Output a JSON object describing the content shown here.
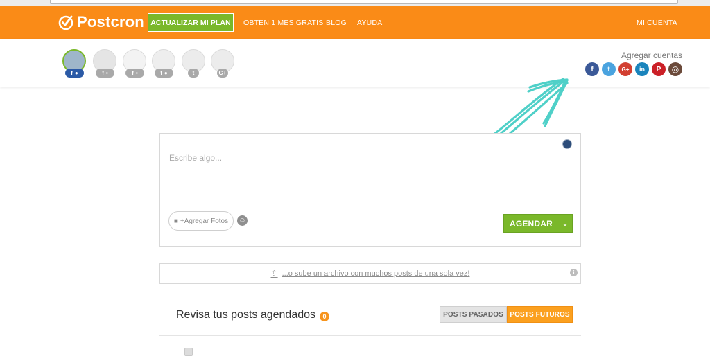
{
  "brand": {
    "name": "Postcron",
    "nav_color": "#fa8b17",
    "green": "#7ab82a"
  },
  "nav": {
    "upgrade_label": "ACTUALIZAR MI PLAN",
    "free_month_label": "OBTÉN 1 MES GRATIS",
    "blog_label": "BLOG",
    "help_label": "AYUDA",
    "account_label": "MI CUENTA"
  },
  "accounts": {
    "add_label": "Agregar cuentas",
    "connected": [
      {
        "network": "facebook",
        "badge": "f",
        "active": true
      },
      {
        "network": "facebook-page",
        "badge": "f",
        "active": false
      },
      {
        "network": "facebook-page",
        "badge": "f",
        "active": false
      },
      {
        "network": "facebook-group",
        "badge": "f",
        "active": false
      },
      {
        "network": "twitter",
        "badge": "t",
        "active": false
      },
      {
        "network": "google-plus",
        "badge": "G+",
        "active": false
      }
    ],
    "add_networks": [
      {
        "name": "facebook",
        "glyph": "f",
        "color": "#3b5998"
      },
      {
        "name": "twitter",
        "glyph": "t",
        "color": "#4aa3df"
      },
      {
        "name": "google-plus",
        "glyph": "G+",
        "color": "#d23f31"
      },
      {
        "name": "linkedin",
        "glyph": "in",
        "color": "#1a84bc"
      },
      {
        "name": "pinterest",
        "glyph": "P",
        "color": "#cb2027"
      },
      {
        "name": "instagram",
        "glyph": "◎",
        "color": "#6b4a3a"
      }
    ]
  },
  "composer": {
    "placeholder": "Escribe algo...",
    "add_photos_label": "+Agregar Fotos",
    "schedule_label": "AGENDAR"
  },
  "upload": {
    "link_label": "...o sube un archivo con muchos posts de una sola vez!"
  },
  "scheduled": {
    "title": "Revisa tus posts agendados",
    "count": "0",
    "tab_past": "POSTS PASADOS",
    "tab_future": "POSTS FUTUROS"
  }
}
